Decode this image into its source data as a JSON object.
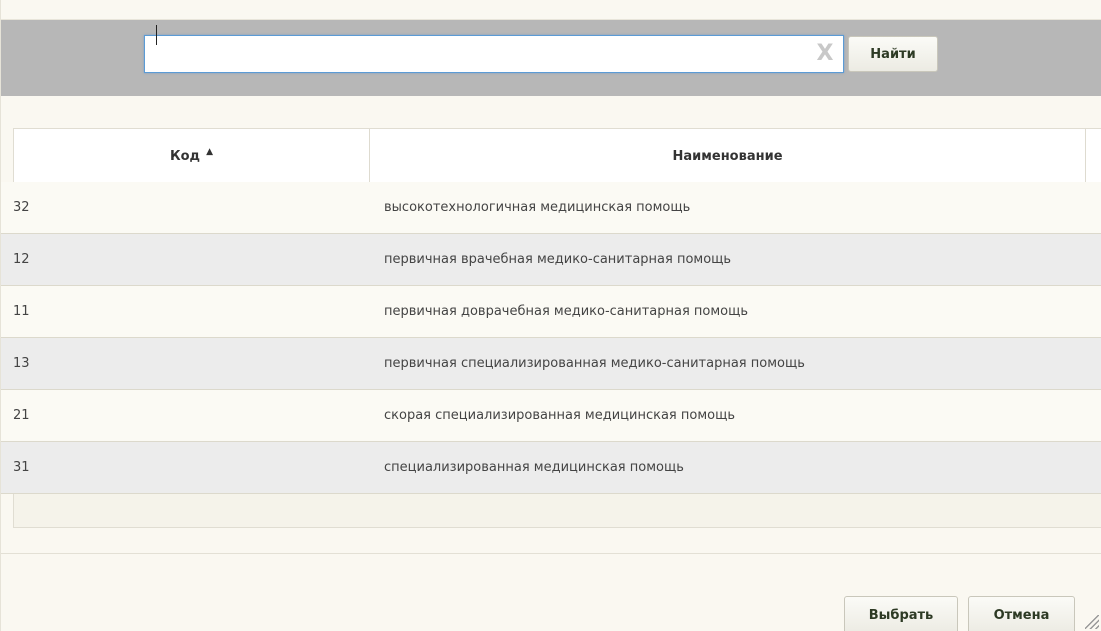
{
  "search": {
    "value": "",
    "clear_icon": "clear-icon",
    "clear_glyph": "X",
    "find_label": "Найти"
  },
  "grid": {
    "columns": [
      {
        "label": "Код",
        "sort": "ascending",
        "sort_glyph": "▲"
      },
      {
        "label": "Наименование"
      }
    ],
    "rows": [
      {
        "code": "32",
        "name": "высокотехнологичная медицинская помощь"
      },
      {
        "code": "12",
        "name": "первичная врачебная медико-санитарная помощь"
      },
      {
        "code": "11",
        "name": "первичная доврачебная медико-санитарная помощь"
      },
      {
        "code": "13",
        "name": "первичная специализированная медико-санитарная помощь"
      },
      {
        "code": "21",
        "name": "скорая специализированная медицинская помощь"
      },
      {
        "code": "31",
        "name": "специализированная медицинская помощь"
      }
    ]
  },
  "footer": {
    "select_label": "Выбрать",
    "cancel_label": "Отмена"
  },
  "colors": {
    "search_bar_bg": "#b7b7b7",
    "row_odd": "#fbfaf4",
    "row_even": "#ececec",
    "input_focus_border": "#5b9bd5"
  }
}
